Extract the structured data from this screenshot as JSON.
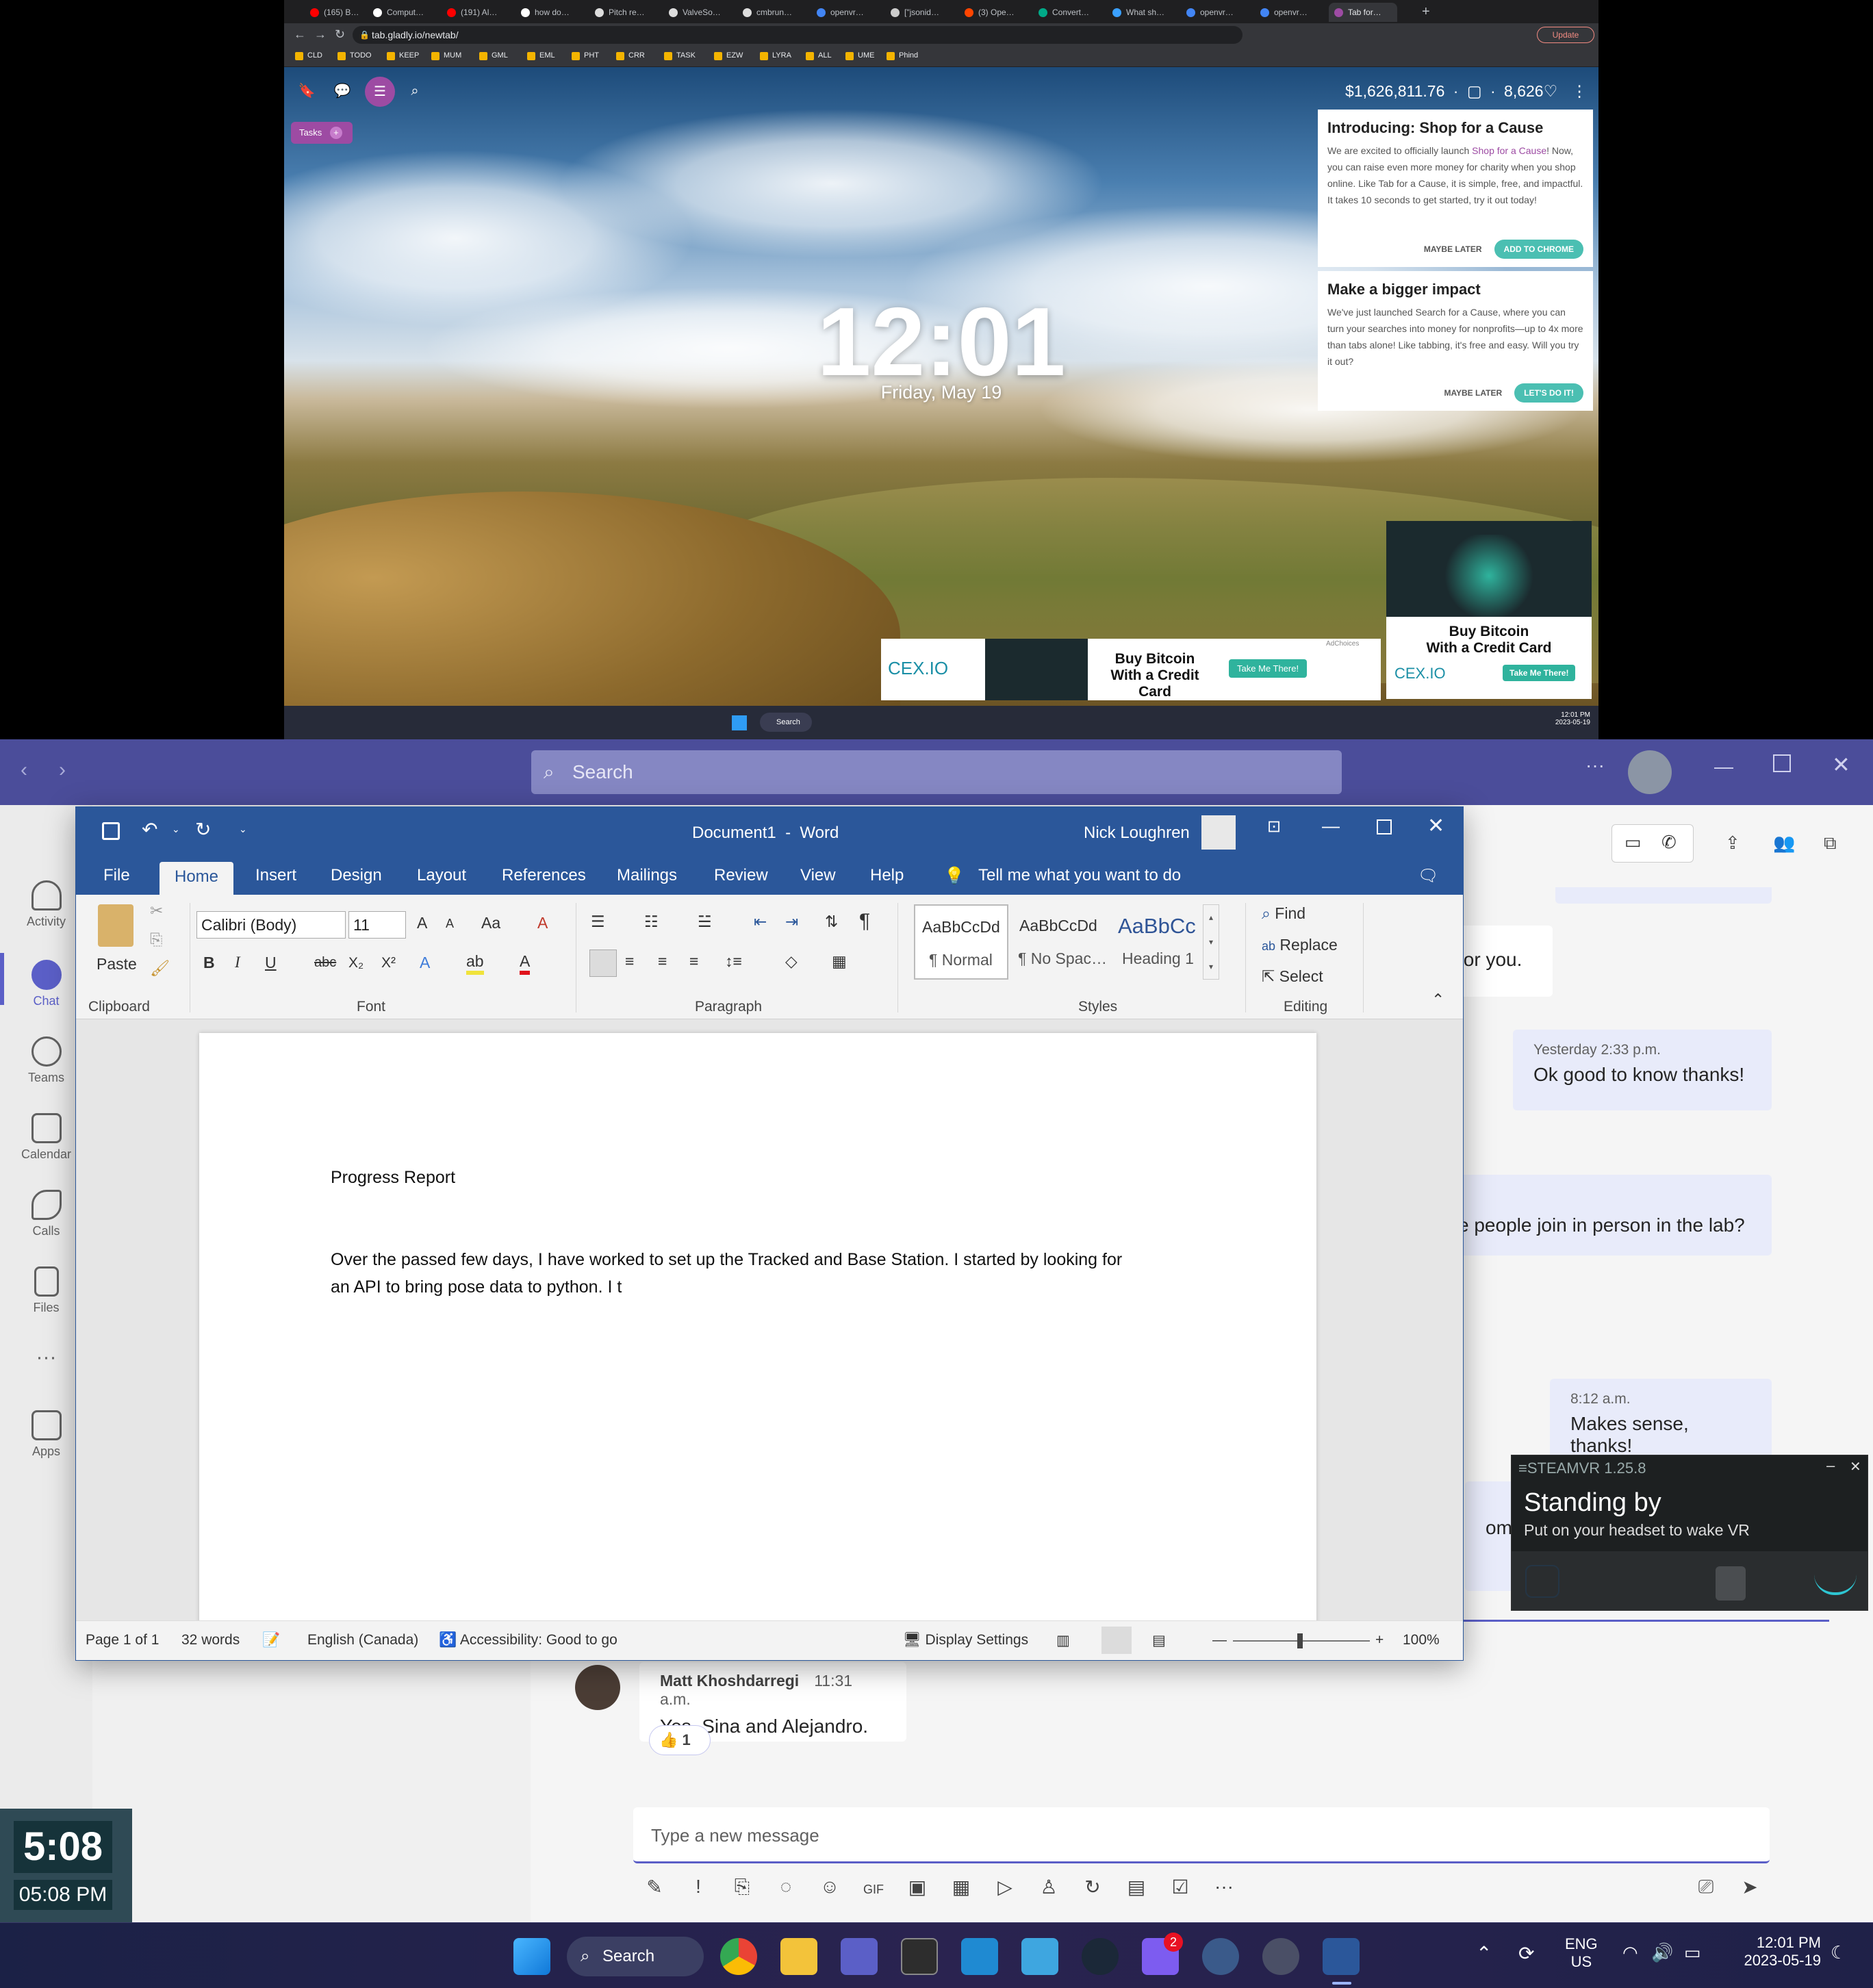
{
  "browser": {
    "tabs": [
      "(165) B…",
      "Comput…",
      "(191) Al…",
      "how do…",
      "Pitch re…",
      "ValveSo…",
      "cmbrun…",
      "openvr…",
      "[\"jsonid…",
      "(3) Ope…",
      "Convert…",
      "What sh…",
      "openvr…",
      "openvr…",
      "Tab for…"
    ],
    "new_tab_symbol": "+",
    "url": "tab.gladly.io/newtab/",
    "update_label": "Update",
    "bookmarks": [
      "CLD",
      "TODO",
      "KEEP",
      "MUM",
      "GML",
      "EML",
      "PHT",
      "CRR",
      "TASK",
      "EZW",
      "LYRA",
      "ALL",
      "UME",
      "Phind"
    ]
  },
  "newtab": {
    "tasks_label": "Tasks",
    "money": "$1,626,811.76",
    "hearts": "8,626",
    "time": "12:01",
    "date": "Friday, May 19",
    "card1": {
      "title": "Introducing: Shop for a Cause",
      "body_a": "We are excited to officially launch ",
      "body_link": "Shop for a Cause",
      "body_b": "! Now, you can raise even more money for charity when you shop online. Like Tab for a Cause, it is simple, free, and impactful. It takes 10 seconds to get started, try it out today!",
      "later": "MAYBE LATER",
      "cta": "ADD TO CHROME"
    },
    "card2": {
      "title": "Make a bigger impact",
      "body": "We've just launched Search for a Cause, where you can turn your searches into money for nonprofits—up to 4x more than tabs alone! Like tabbing, it's free and easy. Will you try it out?",
      "later": "MAYBE LATER",
      "cta": "LET'S DO IT!"
    },
    "ad": {
      "brand": "CEX.IO",
      "headline_1": "Buy Bitcoin",
      "headline_2": "With a Credit Card",
      "cta": "Take Me There!",
      "adchoices": "AdChoices"
    },
    "mini_taskbar": {
      "search": "Search",
      "time": "12:01 PM",
      "date": "2023-05-19"
    }
  },
  "teams": {
    "search_placeholder": "Search",
    "rail": [
      "Activity",
      "Chat",
      "Teams",
      "Calendar",
      "Calls",
      "Files",
      "Apps"
    ],
    "messages": [
      {
        "text": "for you."
      },
      {
        "time": "Yesterday 2:33 p.m.",
        "text": "Ok good to know thanks!"
      },
      {
        "text": "e people join in person in the lab?"
      },
      {
        "time": "8:12 a.m.",
        "text": "Makes sense, thanks!"
      },
      {
        "text": "omebo"
      },
      {
        "author": "Matt Khoshdarregi",
        "time": "11:31 a.m.",
        "text": "Yes, Sina and Alejandro.",
        "reaction_count": "1"
      }
    ],
    "composer_placeholder": "Type a new message",
    "more_dots": "···"
  },
  "word": {
    "doc_title": "Document1  -  Word",
    "user": "Nick Loughren",
    "tabs": [
      "File",
      "Home",
      "Insert",
      "Design",
      "Layout",
      "References",
      "Mailings",
      "Review",
      "View",
      "Help"
    ],
    "tell_me": "Tell me what you want to do",
    "font_name": "Calibri (Body)",
    "font_size": "11",
    "groups": [
      "Clipboard",
      "Font",
      "Paragraph",
      "Styles",
      "Editing"
    ],
    "paste": "Paste",
    "styles": [
      {
        "sample": "AaBbCcDd",
        "name": "¶ Normal"
      },
      {
        "sample": "AaBbCcDd",
        "name": "¶ No Spac…"
      },
      {
        "sample": "AaBbCc",
        "name": "Heading 1"
      }
    ],
    "editing": [
      "Find",
      "Replace",
      "Select"
    ],
    "doc_heading": "Progress Report",
    "doc_line1": "Over the passed few days, I have worked to set up the Tracked and Base Station. I started by looking for",
    "doc_line2": "an API to bring pose data to python. I t",
    "status": {
      "page": "Page 1 of 1",
      "words": "32 words",
      "language": "English (Canada)",
      "accessibility": "Accessibility: Good to go",
      "display": "Display Settings",
      "zoom": "100%"
    }
  },
  "steamvr": {
    "title": "STEAMVR 1.25.8",
    "status": "Standing by",
    "hint": "Put on your headset to wake VR"
  },
  "widget": {
    "big_time": "5:08",
    "small_time": "05:08 PM"
  },
  "taskbar": {
    "search": "Search",
    "badge": "2",
    "lang1": "ENG",
    "lang2": "US",
    "time": "12:01 PM",
    "date": "2023-05-19"
  },
  "colors": {
    "teams_purple": "#4b4d9a",
    "word_blue": "#2b579a",
    "tab_teal": "#4bbfb2",
    "tab_purple": "#9d4ba3"
  }
}
